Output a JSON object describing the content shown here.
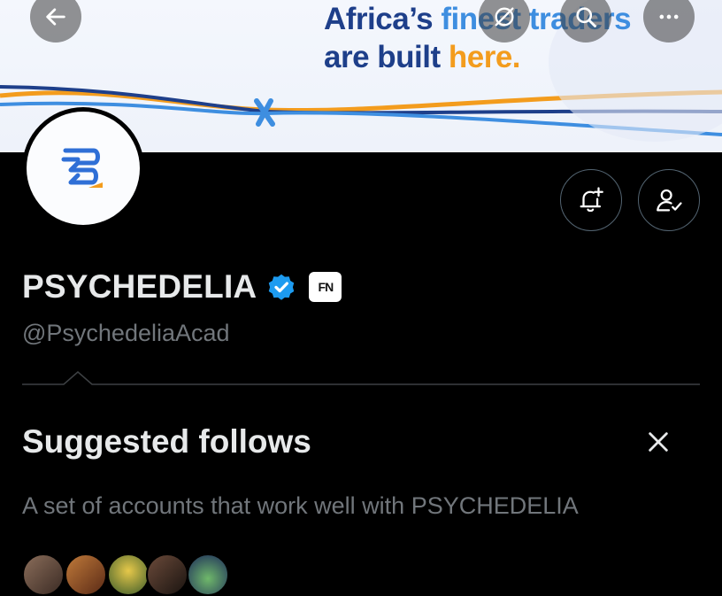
{
  "banner": {
    "line1_part1": "Africa’s ",
    "line1_part2": "finest traders",
    "line2_part1": "are built ",
    "line2_part2": "here."
  },
  "topbar": {
    "back_icon": "arrow-left-icon",
    "search_icon": "search-icon",
    "grok_icon": "grok-icon",
    "more_icon": "more-horizontal-icon"
  },
  "profile": {
    "display_name": "PSYCHEDELIA",
    "handle": "@PsychedeliaAcad",
    "affiliation_badge": "FN",
    "verified_color": "#1d9bf0"
  },
  "actions": {
    "notify_icon": "bell-plus-icon",
    "following_icon": "person-check-icon"
  },
  "suggested": {
    "title": "Suggested follows",
    "description": "A set of accounts that work well with PSYCHEDELIA",
    "close_icon": "close-icon"
  },
  "colors": {
    "background": "#000000",
    "text_primary": "#e7e9ea",
    "text_secondary": "#71767b",
    "brand_blue": "#1e3f8a",
    "brand_orange": "#f39c1d"
  }
}
